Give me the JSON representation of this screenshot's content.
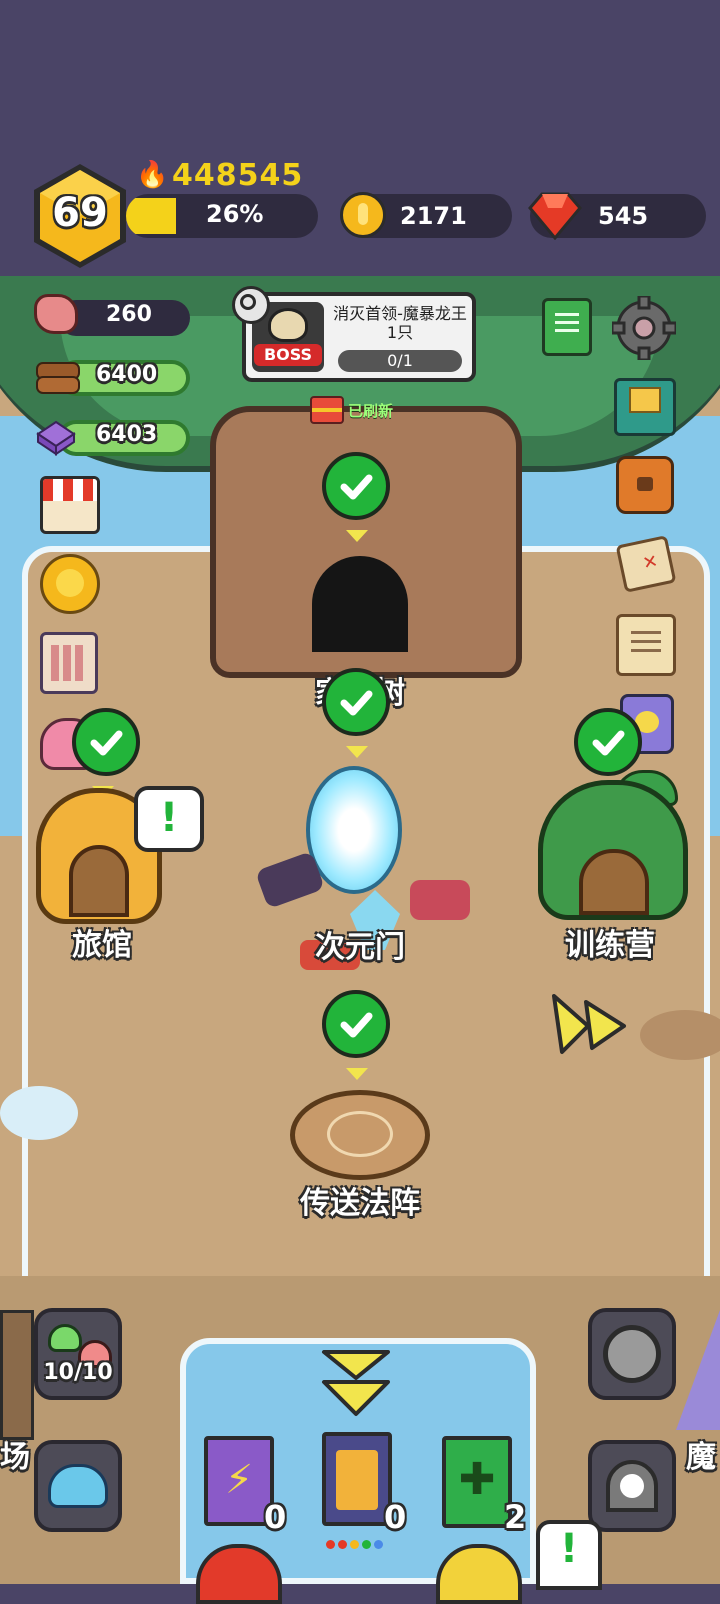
{
  "player": {
    "level": "69",
    "power": "448545",
    "exp_percent_label": "26%",
    "exp_progress": 0.26
  },
  "currencies": {
    "gold": "2171",
    "gems": "545"
  },
  "resources": {
    "meat": "260",
    "wood": "6400",
    "crystal": "6403"
  },
  "quest": {
    "badge": "BOSS",
    "title": "消灭首领-魔暴龙王1只",
    "progress": "0/1"
  },
  "refresh_label": "已刷新",
  "buildings": {
    "tree": "家园树",
    "inn": "旅馆",
    "portal": "次元门",
    "training": "训练营",
    "teleport": "传送法阵",
    "left_edge": "场",
    "right_edge": "魔"
  },
  "bottom": {
    "slime_counter": "10/10",
    "book_purple_count": "0",
    "book_gold_count": "0",
    "book_green_count": "2"
  },
  "colors": {
    "top_bg": "#4a4466",
    "ground": "#c8a77e",
    "water": "#86c8ea",
    "check_green": "#22b43a",
    "level_hex": "#f5b81c",
    "exp_bar": "#f4d21a"
  }
}
